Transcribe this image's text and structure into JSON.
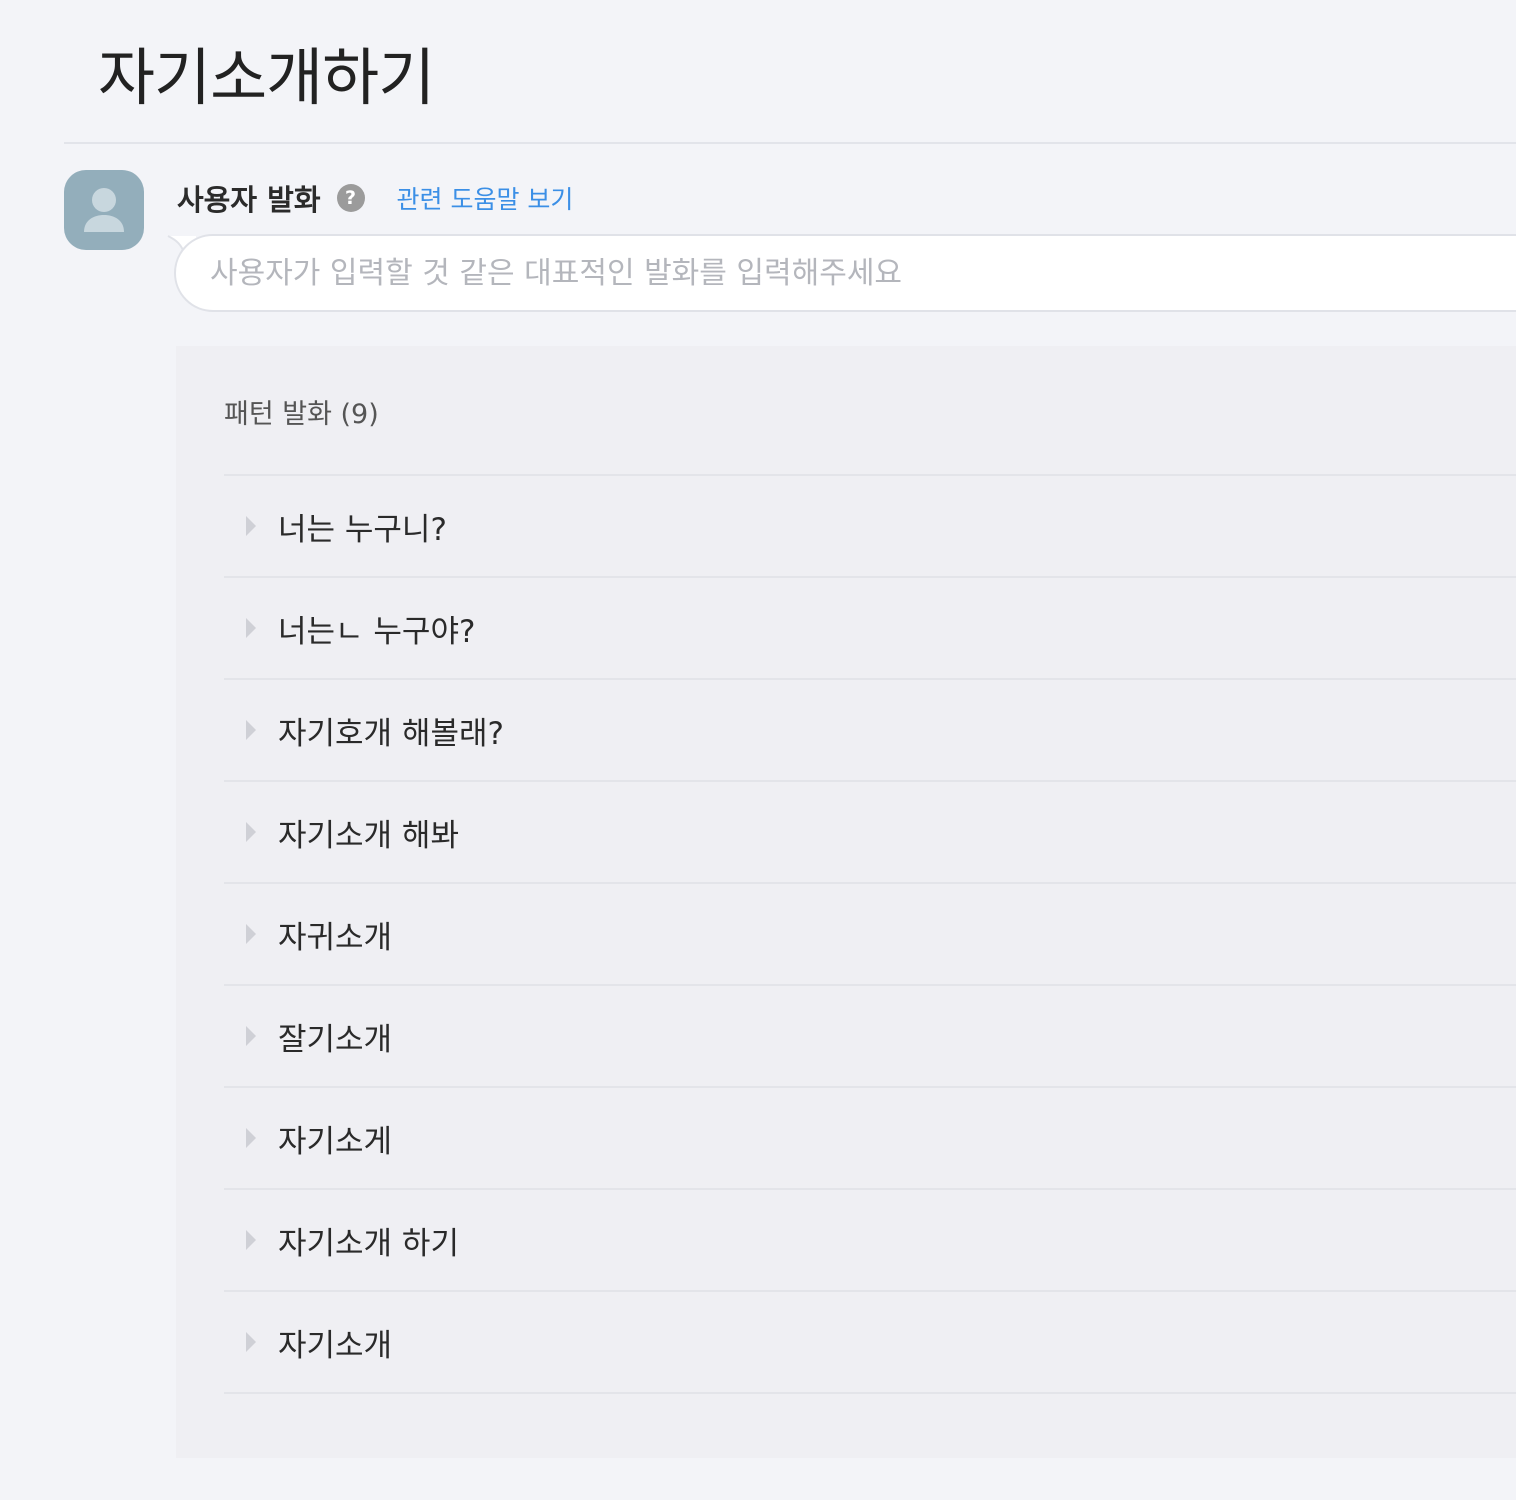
{
  "page": {
    "title": "자기소개하기"
  },
  "user_utterance": {
    "label": "사용자 발화",
    "help_icon_glyph": "?",
    "help_link": "관련 도움말 보기",
    "input_value": "",
    "input_placeholder": "사용자가 입력할 것 같은 대표적인 발화를 입력해주세요"
  },
  "patterns": {
    "header": "패턴 발화 (9)",
    "items": [
      {
        "text": "너는 누구니?"
      },
      {
        "text": "너는ㄴ 누구야?"
      },
      {
        "text": "자기호개 해볼래?"
      },
      {
        "text": "자기소개 해봐"
      },
      {
        "text": "자귀소개"
      },
      {
        "text": "잘기소개"
      },
      {
        "text": "자기소게"
      },
      {
        "text": "자기소개 하기"
      },
      {
        "text": "자기소개"
      }
    ]
  },
  "icons": {
    "avatar": "user-silhouette-icon",
    "help": "question-circle-icon",
    "expand": "caret-right-icon"
  },
  "colors": {
    "background": "#f3f4f8",
    "panel": "#efeff3",
    "avatar": "#93aebb",
    "link": "#3b8fe6",
    "help_icon": "#9b9b9b"
  }
}
